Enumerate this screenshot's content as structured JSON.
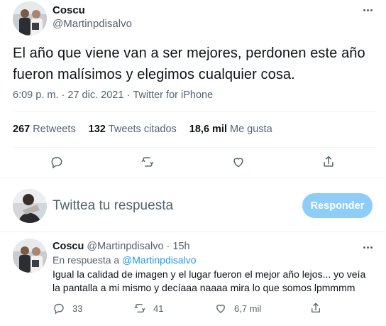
{
  "main_tweet": {
    "display_name": "Coscu",
    "handle": "@Martinpdisalvo",
    "text": "El año que viene van a ser mejores, perdonen este año fueron malísimos y elegimos cualquier cosa.",
    "time": "6:09 p. m.",
    "separator": "·",
    "date": "27 dic. 2021",
    "source": "Twitter for iPhone",
    "stats": [
      {
        "value": "267",
        "label": "Retweets"
      },
      {
        "value": "132",
        "label": "Tweets citados"
      },
      {
        "value": "18,6 mil",
        "label": "Me gusta"
      }
    ],
    "actions": [
      "reply-icon",
      "retweet-icon",
      "like-icon",
      "share-icon"
    ]
  },
  "compose": {
    "placeholder": "Twittea tu respuesta",
    "button_label": "Responder",
    "button_color": "#8ecdf8"
  },
  "reply_tweet": {
    "display_name": "Coscu",
    "handle": "@Martinpdisalvo",
    "separator": "·",
    "age": "15h",
    "in_reply_prefix": "En respuesta a",
    "in_reply_mention": "@Martinpdisalvo",
    "text": "Igual la calidad de imagen y el lugar fueron el mejor año lejos... yo veía la pantalla a mi mismo y decíaaa naaaa mira lo que somos lpmmmm",
    "reply_count": "33",
    "retweet_count": "41",
    "like_count": "6,7 mil"
  },
  "colors": {
    "accent": "#1d9bf0",
    "text": "#0f1419",
    "secondary": "#536471",
    "divider": "#eff3f4"
  }
}
